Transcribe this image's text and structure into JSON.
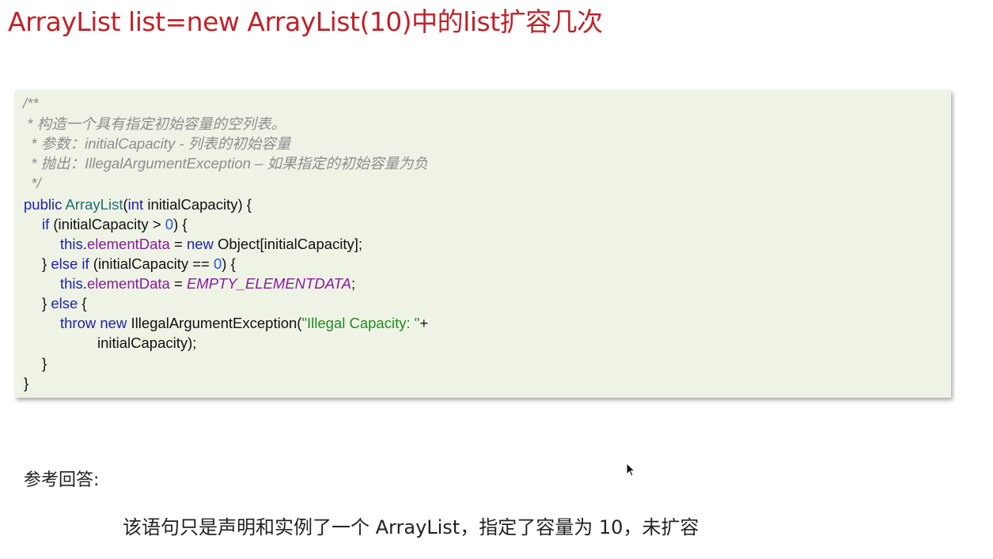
{
  "slide": {
    "title": "ArrayList list=new ArrayList(10)中的list扩容几次"
  },
  "code": {
    "comment_open": "/**",
    "comment_line1": " * 构造一个具有指定初始容量的空列表。",
    "comment_line2": "  * 参数：initialCapacity - 列表的初始容量",
    "comment_line3": "  * 抛出：IllegalArgumentException – 如果指定的初始容量为负",
    "comment_close": "  */",
    "line6": {
      "kw_public": "public",
      "ctor": "ArrayList",
      "paren": "(",
      "kw_int": "int",
      "rest": " initialCapacity) {"
    },
    "line7": {
      "kw_if": "if",
      "cond": " (initialCapacity > ",
      "num": "0",
      "end": ") {"
    },
    "line8": {
      "kw_this": "this",
      "dot": ".",
      "field": "elementData",
      "eq": " = ",
      "kw_new": "new",
      "rest": " Object[initialCapacity];"
    },
    "line9": {
      "brace": "} ",
      "kw_else": "else",
      "sp": " ",
      "kw_if": "if",
      "cond": " (initialCapacity == ",
      "num": "0",
      "end": ") {"
    },
    "line10": {
      "kw_this": "this",
      "dot": ".",
      "field": "elementData",
      "eq": " = ",
      "const": "EMPTY_ELEMENTDATA",
      "end": ";"
    },
    "line11": {
      "brace": "} ",
      "kw_else": "else",
      "end": " {"
    },
    "line12": {
      "kw_throw": "throw",
      "sp": " ",
      "kw_new": "new",
      "cls": " IllegalArgumentException(",
      "str": "\"Illegal Capacity: \"",
      "plus": "+"
    },
    "line13": "initialCapacity);",
    "line14": "}",
    "line15": "}"
  },
  "answer": {
    "heading": "参考回答:",
    "text": "该语句只是声明和实例了一个 ArrayList，指定了容量为 10，未扩容"
  },
  "icons": {
    "cursor": "mouse-pointer-icon"
  }
}
